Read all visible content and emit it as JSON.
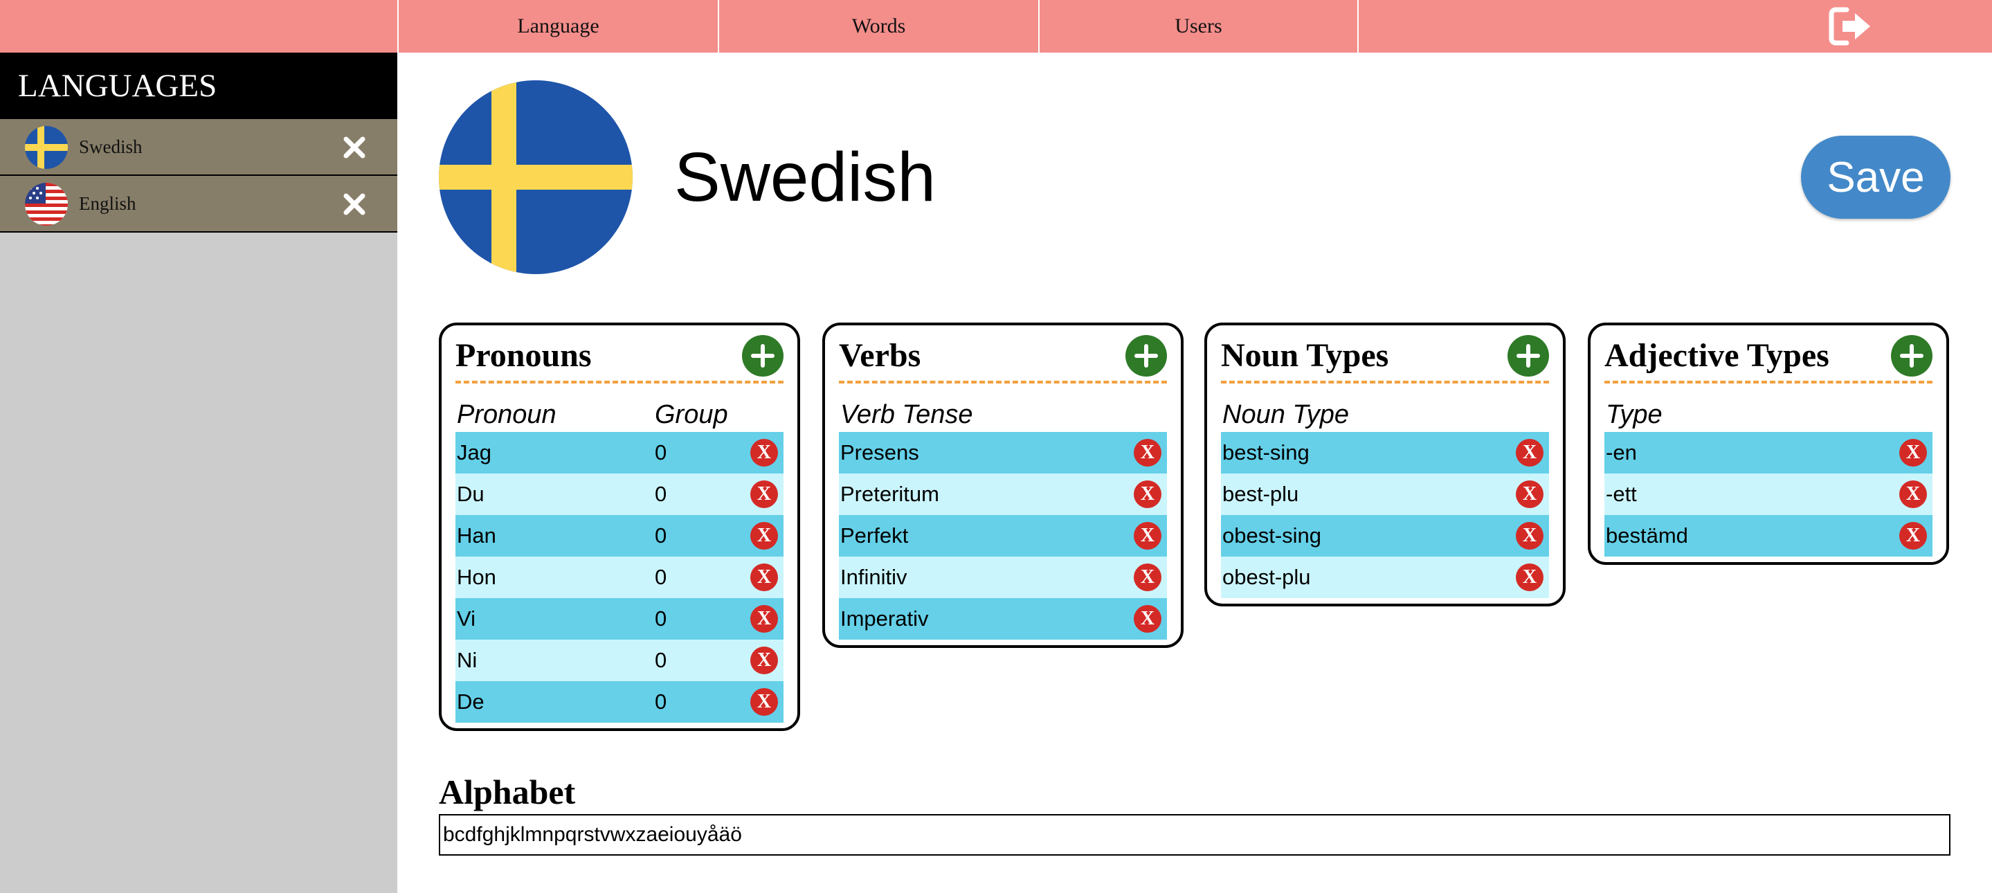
{
  "nav": {
    "tabs": [
      "Language",
      "Words",
      "Users"
    ],
    "logout_icon": "logout-icon"
  },
  "sidebar": {
    "title": "LANGUAGES",
    "items": [
      {
        "label": "Swedish",
        "flag": "sweden-flag-icon"
      },
      {
        "label": "English",
        "flag": "usa-flag-icon"
      }
    ]
  },
  "main": {
    "language_name": "Swedish",
    "save_label": "Save"
  },
  "cards": {
    "pronouns": {
      "title": "Pronouns",
      "col1": "Pronoun",
      "col2": "Group",
      "rows": [
        {
          "name": "Jag",
          "group": "0"
        },
        {
          "name": "Du",
          "group": "0"
        },
        {
          "name": "Han",
          "group": "0"
        },
        {
          "name": "Hon",
          "group": "0"
        },
        {
          "name": "Vi",
          "group": "0"
        },
        {
          "name": "Ni",
          "group": "0"
        },
        {
          "name": "De",
          "group": "0"
        }
      ]
    },
    "verbs": {
      "title": "Verbs",
      "col1": "Verb Tense",
      "rows": [
        "Presens",
        "Preteritum",
        "Perfekt",
        "Infinitiv",
        "Imperativ"
      ]
    },
    "nouns": {
      "title": "Noun Types",
      "col1": "Noun Type",
      "rows": [
        "best-sing",
        "best-plu",
        "obest-sing",
        "obest-plu"
      ]
    },
    "adjectives": {
      "title": "Adjective Types",
      "col1": "Type",
      "rows": [
        "-en",
        "-ett",
        "bestämd"
      ]
    }
  },
  "alphabet": {
    "label": "Alphabet",
    "value": "bcdfghjklmnpqrstvwxzaeiouyåäö"
  },
  "remove_glyph": "X",
  "colors": {
    "topbar": "#f48e8b",
    "sidebar_item": "#877e69",
    "save": "#4389c9",
    "row_dark": "#65d0e8",
    "row_light": "#cbf5fc",
    "add": "#2e7a27",
    "remove": "#d42a26",
    "rule": "#f3a03f"
  }
}
